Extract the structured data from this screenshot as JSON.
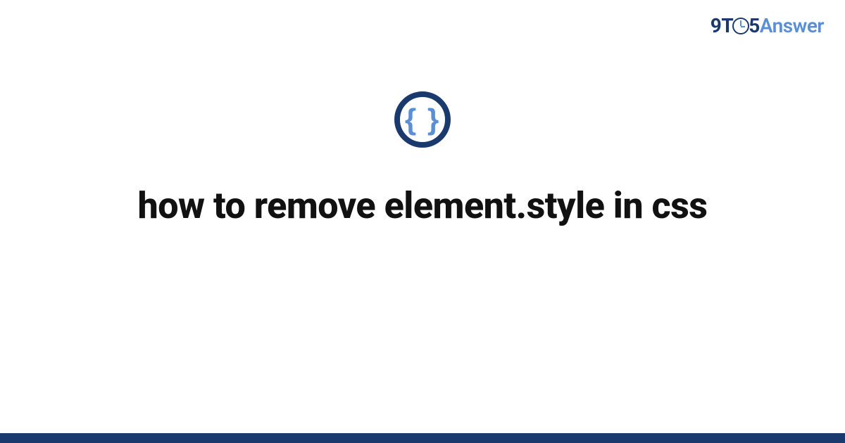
{
  "brand": {
    "part1": "9T",
    "part2": "5",
    "part3": "Answer"
  },
  "topic_icon": {
    "glyph": "{ }",
    "name": "css-braces-icon"
  },
  "title": "how to remove element.style in css",
  "colors": {
    "dark_blue": "#1a3a6e",
    "light_blue": "#5a8fd6",
    "text": "#111111",
    "background": "#ffffff"
  }
}
